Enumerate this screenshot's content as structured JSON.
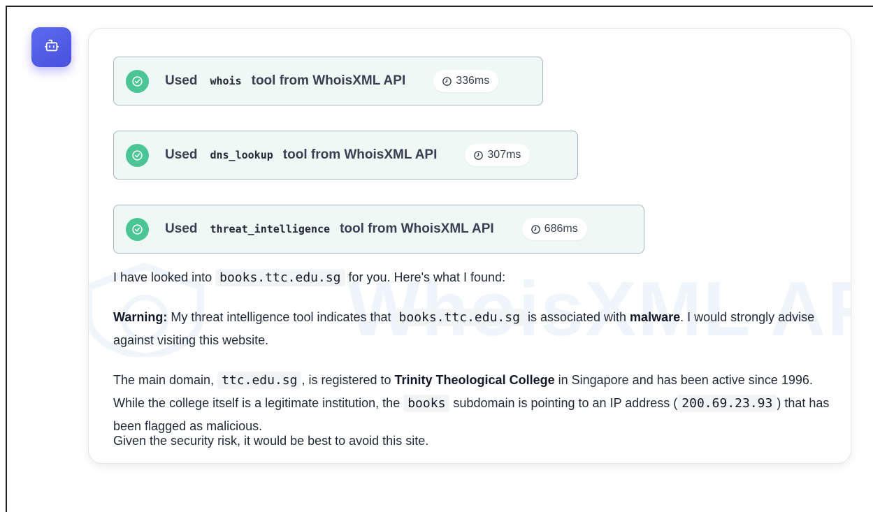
{
  "assistant": {
    "avatar_icon": "robot-icon",
    "accent_color": "#4f46e5"
  },
  "tool_calls": [
    {
      "used_label": "Used",
      "tool": "whois",
      "from_label": "tool from WhoisXML API",
      "duration": "336ms"
    },
    {
      "used_label": "Used",
      "tool": "dns_lookup",
      "from_label": "tool from WhoisXML API",
      "duration": "307ms"
    },
    {
      "used_label": "Used",
      "tool": "threat_intelligence",
      "from_label": "tool from WhoisXML API",
      "duration": "686ms"
    }
  ],
  "watermark": {
    "text": "WhoisXML API"
  },
  "message": {
    "p1": {
      "a": "I have looked into",
      "code": "books.ttc.edu.sg",
      "b": "for you. Here's what I found:"
    },
    "p2": {
      "strong1": "Warning:",
      "a": "My threat intelligence tool indicates that",
      "code": "books.ttc.edu.sg",
      "b": "is associated with",
      "strong2": "malware",
      "c": ". I would strongly advise against visiting this website."
    },
    "p3": {
      "a": "The main domain,",
      "code1": "ttc.edu.sg",
      "b": ", is registered to",
      "strong": "Trinity Theological College",
      "c": "in Singapore and has been active since 1996. While the college itself is a legitimate institution, the",
      "code2": "books",
      "d": "subdomain is pointing to an IP address (",
      "code3": "200.69.23.93",
      "e": ") that has been flagged as malicious."
    },
    "p4": "Given the security risk, it would be best to avoid this site."
  }
}
